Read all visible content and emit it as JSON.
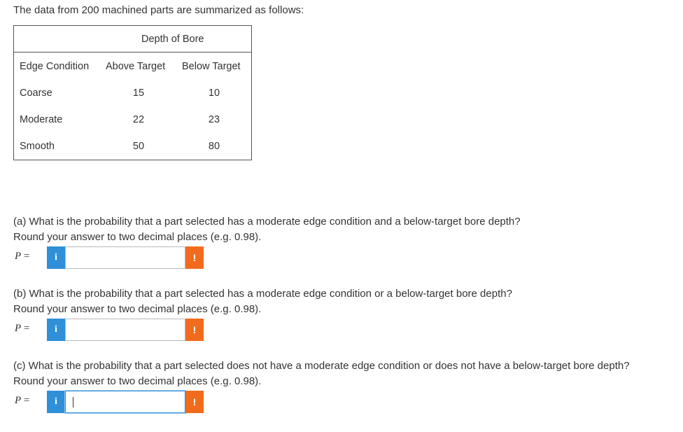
{
  "intro": "The data from 200 machined parts are summarized as follows:",
  "table": {
    "group_header": "Depth of Bore",
    "headers": [
      "Edge Condition",
      "Above Target",
      "Below Target"
    ],
    "rows": [
      {
        "label": "Coarse",
        "above": "15",
        "below": "10"
      },
      {
        "label": "Moderate",
        "above": "22",
        "below": "23"
      },
      {
        "label": "Smooth",
        "above": "50",
        "below": "80"
      }
    ]
  },
  "questions": [
    {
      "text": "(a) What is the probability that a part selected has a moderate edge condition and a below-target bore depth?",
      "instruction": "Round your answer to two decimal places (e.g. 0.98).",
      "p_symbol": "P",
      "equals": "=",
      "info_icon": "i",
      "warn_icon": "!",
      "value": ""
    },
    {
      "text": "(b) What is the probability that a part selected has a moderate edge condition or a below-target bore depth?",
      "instruction": "Round your answer to two decimal places (e.g. 0.98).",
      "p_symbol": "P",
      "equals": "=",
      "info_icon": "i",
      "warn_icon": "!",
      "value": ""
    },
    {
      "text": "(c) What is the probability that a part selected does not have a moderate edge condition or does not have a below-target bore depth?",
      "instruction": "Round your answer to two decimal places (e.g. 0.98).",
      "p_symbol": "P",
      "equals": "=",
      "info_icon": "i",
      "warn_icon": "!",
      "value": ""
    }
  ],
  "colors": {
    "info": "#2f8fd8",
    "warning": "#f26b1d",
    "text": "#333333"
  }
}
